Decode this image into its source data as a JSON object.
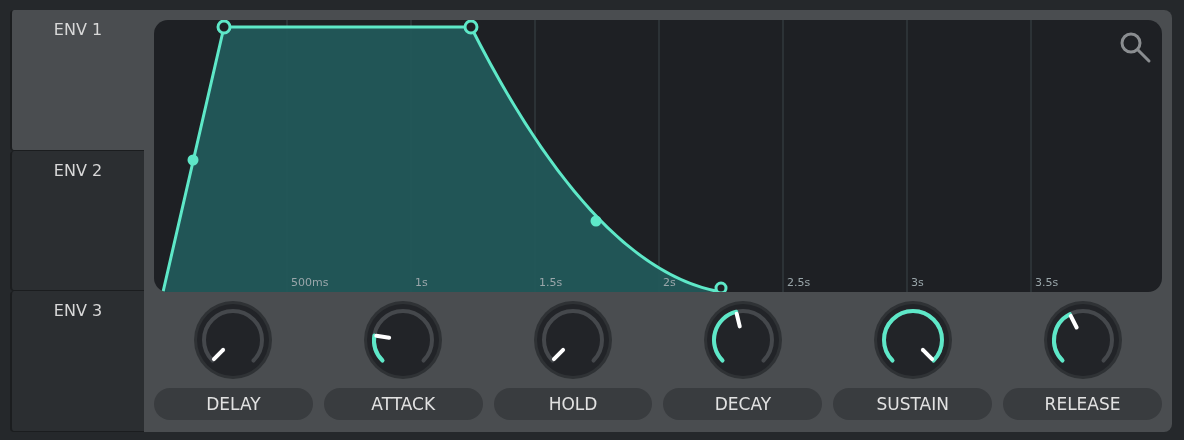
{
  "tabs": [
    {
      "label": "ENV 1",
      "selected": true
    },
    {
      "label": "ENV 2",
      "selected": false
    },
    {
      "label": "ENV 3",
      "selected": false
    }
  ],
  "envelope": {
    "time_labels": [
      "500ms",
      "1s",
      "1.5s",
      "2s",
      "2.5s",
      "3s",
      "3.5s"
    ]
  },
  "knobs": [
    {
      "label": "DELAY"
    },
    {
      "label": "ATTACK"
    },
    {
      "label": "HOLD"
    },
    {
      "label": "DECAY"
    },
    {
      "label": "SUSTAIN"
    },
    {
      "label": "RELEASE"
    }
  ]
}
